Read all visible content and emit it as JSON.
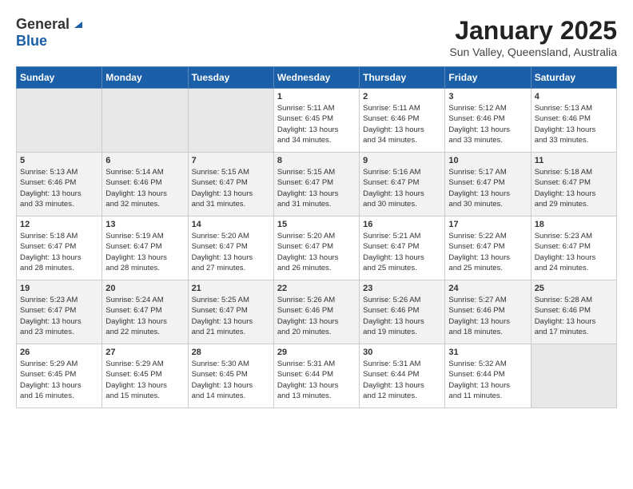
{
  "header": {
    "logo_line1": "General",
    "logo_line2": "Blue",
    "month": "January 2025",
    "location": "Sun Valley, Queensland, Australia"
  },
  "days_of_week": [
    "Sunday",
    "Monday",
    "Tuesday",
    "Wednesday",
    "Thursday",
    "Friday",
    "Saturday"
  ],
  "weeks": [
    [
      {
        "day": "",
        "info": ""
      },
      {
        "day": "",
        "info": ""
      },
      {
        "day": "",
        "info": ""
      },
      {
        "day": "1",
        "info": "Sunrise: 5:11 AM\nSunset: 6:45 PM\nDaylight: 13 hours\nand 34 minutes."
      },
      {
        "day": "2",
        "info": "Sunrise: 5:11 AM\nSunset: 6:46 PM\nDaylight: 13 hours\nand 34 minutes."
      },
      {
        "day": "3",
        "info": "Sunrise: 5:12 AM\nSunset: 6:46 PM\nDaylight: 13 hours\nand 33 minutes."
      },
      {
        "day": "4",
        "info": "Sunrise: 5:13 AM\nSunset: 6:46 PM\nDaylight: 13 hours\nand 33 minutes."
      }
    ],
    [
      {
        "day": "5",
        "info": "Sunrise: 5:13 AM\nSunset: 6:46 PM\nDaylight: 13 hours\nand 33 minutes."
      },
      {
        "day": "6",
        "info": "Sunrise: 5:14 AM\nSunset: 6:46 PM\nDaylight: 13 hours\nand 32 minutes."
      },
      {
        "day": "7",
        "info": "Sunrise: 5:15 AM\nSunset: 6:47 PM\nDaylight: 13 hours\nand 31 minutes."
      },
      {
        "day": "8",
        "info": "Sunrise: 5:15 AM\nSunset: 6:47 PM\nDaylight: 13 hours\nand 31 minutes."
      },
      {
        "day": "9",
        "info": "Sunrise: 5:16 AM\nSunset: 6:47 PM\nDaylight: 13 hours\nand 30 minutes."
      },
      {
        "day": "10",
        "info": "Sunrise: 5:17 AM\nSunset: 6:47 PM\nDaylight: 13 hours\nand 30 minutes."
      },
      {
        "day": "11",
        "info": "Sunrise: 5:18 AM\nSunset: 6:47 PM\nDaylight: 13 hours\nand 29 minutes."
      }
    ],
    [
      {
        "day": "12",
        "info": "Sunrise: 5:18 AM\nSunset: 6:47 PM\nDaylight: 13 hours\nand 28 minutes."
      },
      {
        "day": "13",
        "info": "Sunrise: 5:19 AM\nSunset: 6:47 PM\nDaylight: 13 hours\nand 28 minutes."
      },
      {
        "day": "14",
        "info": "Sunrise: 5:20 AM\nSunset: 6:47 PM\nDaylight: 13 hours\nand 27 minutes."
      },
      {
        "day": "15",
        "info": "Sunrise: 5:20 AM\nSunset: 6:47 PM\nDaylight: 13 hours\nand 26 minutes."
      },
      {
        "day": "16",
        "info": "Sunrise: 5:21 AM\nSunset: 6:47 PM\nDaylight: 13 hours\nand 25 minutes."
      },
      {
        "day": "17",
        "info": "Sunrise: 5:22 AM\nSunset: 6:47 PM\nDaylight: 13 hours\nand 25 minutes."
      },
      {
        "day": "18",
        "info": "Sunrise: 5:23 AM\nSunset: 6:47 PM\nDaylight: 13 hours\nand 24 minutes."
      }
    ],
    [
      {
        "day": "19",
        "info": "Sunrise: 5:23 AM\nSunset: 6:47 PM\nDaylight: 13 hours\nand 23 minutes."
      },
      {
        "day": "20",
        "info": "Sunrise: 5:24 AM\nSunset: 6:47 PM\nDaylight: 13 hours\nand 22 minutes."
      },
      {
        "day": "21",
        "info": "Sunrise: 5:25 AM\nSunset: 6:47 PM\nDaylight: 13 hours\nand 21 minutes."
      },
      {
        "day": "22",
        "info": "Sunrise: 5:26 AM\nSunset: 6:46 PM\nDaylight: 13 hours\nand 20 minutes."
      },
      {
        "day": "23",
        "info": "Sunrise: 5:26 AM\nSunset: 6:46 PM\nDaylight: 13 hours\nand 19 minutes."
      },
      {
        "day": "24",
        "info": "Sunrise: 5:27 AM\nSunset: 6:46 PM\nDaylight: 13 hours\nand 18 minutes."
      },
      {
        "day": "25",
        "info": "Sunrise: 5:28 AM\nSunset: 6:46 PM\nDaylight: 13 hours\nand 17 minutes."
      }
    ],
    [
      {
        "day": "26",
        "info": "Sunrise: 5:29 AM\nSunset: 6:45 PM\nDaylight: 13 hours\nand 16 minutes."
      },
      {
        "day": "27",
        "info": "Sunrise: 5:29 AM\nSunset: 6:45 PM\nDaylight: 13 hours\nand 15 minutes."
      },
      {
        "day": "28",
        "info": "Sunrise: 5:30 AM\nSunset: 6:45 PM\nDaylight: 13 hours\nand 14 minutes."
      },
      {
        "day": "29",
        "info": "Sunrise: 5:31 AM\nSunset: 6:44 PM\nDaylight: 13 hours\nand 13 minutes."
      },
      {
        "day": "30",
        "info": "Sunrise: 5:31 AM\nSunset: 6:44 PM\nDaylight: 13 hours\nand 12 minutes."
      },
      {
        "day": "31",
        "info": "Sunrise: 5:32 AM\nSunset: 6:44 PM\nDaylight: 13 hours\nand 11 minutes."
      },
      {
        "day": "",
        "info": ""
      }
    ]
  ]
}
